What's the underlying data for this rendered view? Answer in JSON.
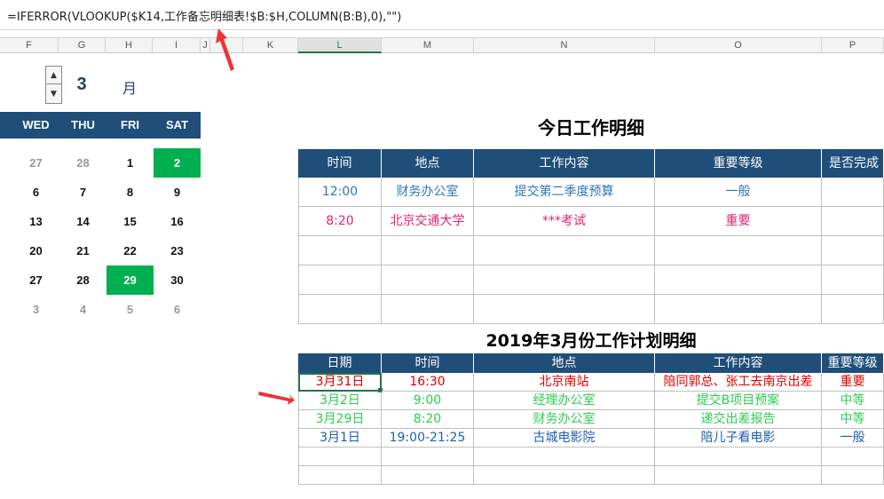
{
  "formula_bar": {
    "text": "=IFERROR(VLOOKUP($K14,工作备忘明细表!$B:$H,COLUMN(B:B),0),\"\")"
  },
  "column_headers": [
    "F",
    "G",
    "H",
    "I",
    "J",
    "K",
    "L",
    "M",
    "N",
    "O",
    "P"
  ],
  "month_selector": {
    "value": "3",
    "unit": "月",
    "up_icon": "▲",
    "down_icon": "▼"
  },
  "calendar": {
    "weekdays": [
      "WED",
      "THU",
      "FRI",
      "SAT"
    ],
    "rows": [
      [
        "27",
        "28",
        "1",
        "2"
      ],
      [
        "6",
        "7",
        "8",
        "9"
      ],
      [
        "13",
        "14",
        "15",
        "16"
      ],
      [
        "20",
        "21",
        "22",
        "23"
      ],
      [
        "27",
        "28",
        "29",
        "30"
      ],
      [
        "3",
        "4",
        "5",
        "6"
      ]
    ],
    "highlight_color": "#00b050"
  },
  "today_table": {
    "title": "今日工作明细",
    "headers": [
      "时间",
      "地点",
      "工作内容",
      "重要等级",
      "是否完成"
    ],
    "rows": [
      [
        "12:00",
        "财务办公室",
        "提交第二季度预算",
        "一般",
        ""
      ],
      [
        "8:20",
        "北京交通大学",
        "***考试",
        "重要",
        ""
      ],
      [
        "",
        "",
        "",
        "",
        ""
      ],
      [
        "",
        "",
        "",
        "",
        ""
      ],
      [
        "",
        "",
        "",
        "",
        ""
      ]
    ]
  },
  "month_table": {
    "title": "2019年3月份工作计划明细",
    "headers": [
      "日期",
      "时间",
      "地点",
      "工作内容",
      "重要等级"
    ],
    "rows": [
      [
        "3月31日",
        "16:30",
        "北京南站",
        "陪同郭总、张工去南京出差",
        "重要"
      ],
      [
        "3月2日",
        "9:00",
        "经理办公室",
        "提交B项目预案",
        "中等"
      ],
      [
        "3月29日",
        "8:20",
        "财务办公室",
        "递交出差报告",
        "中等"
      ],
      [
        "3月1日",
        "19:00-21:25",
        "古城电影院",
        "陪儿子看电影",
        "一般"
      ],
      [
        "",
        "",
        "",
        "",
        ""
      ],
      [
        "",
        "",
        "",
        "",
        ""
      ]
    ]
  },
  "colors": {
    "header_bg": "#1f4e79",
    "accent_green": "#217346",
    "arrow_red": "#ee3333"
  }
}
